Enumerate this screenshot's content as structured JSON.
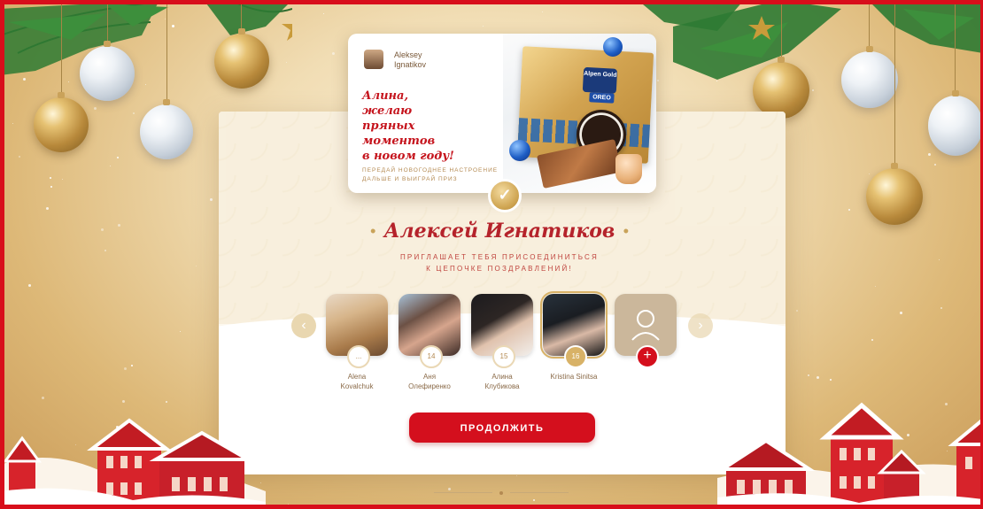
{
  "card": {
    "author_first": "Aleksey",
    "author_last": "Ignatikov",
    "greeting_lines": [
      "Алина,",
      "желаю пряных",
      "моментов",
      "в новом году!"
    ],
    "cta_lines": [
      "ПЕРЕДАЙ НОВОГОДНЕЕ НАСТРОЕНИЕ",
      "ДАЛЬШЕ И ВЫИГРАЙ ПРИЗ"
    ],
    "brand_top": "Alpen Gold",
    "brand_oreo": "OREO"
  },
  "check_icon": "✓",
  "inviter": {
    "name": "Алексей Игнатиков",
    "text_lines": [
      "ПРИГЛАШАЕТ ТЕБЯ ПРИСОЕДИНИТЬСЯ",
      "К ЦЕПОЧКЕ ПОЗДРАВЛЕНИЙ!"
    ]
  },
  "carousel": {
    "prev_icon": "‹",
    "next_icon": "›",
    "friends": [
      {
        "badge": "...",
        "name_lines": [
          "Alena",
          "Kovalchuk"
        ]
      },
      {
        "badge": "14",
        "name_lines": [
          "Аня",
          "Олефиренко"
        ]
      },
      {
        "badge": "15",
        "name_lines": [
          "Алина",
          "Клубикова"
        ]
      },
      {
        "badge": "16",
        "name_lines": [
          "Kristina Sinitsa",
          ""
        ]
      },
      {
        "badge": "+",
        "name_lines": [
          "",
          ""
        ]
      }
    ]
  },
  "continue_label": "ПРОДОЛЖИТЬ",
  "colors": {
    "brand_red": "#d40f1d",
    "gold": "#cfa552",
    "panel": "#fdf8ee"
  }
}
